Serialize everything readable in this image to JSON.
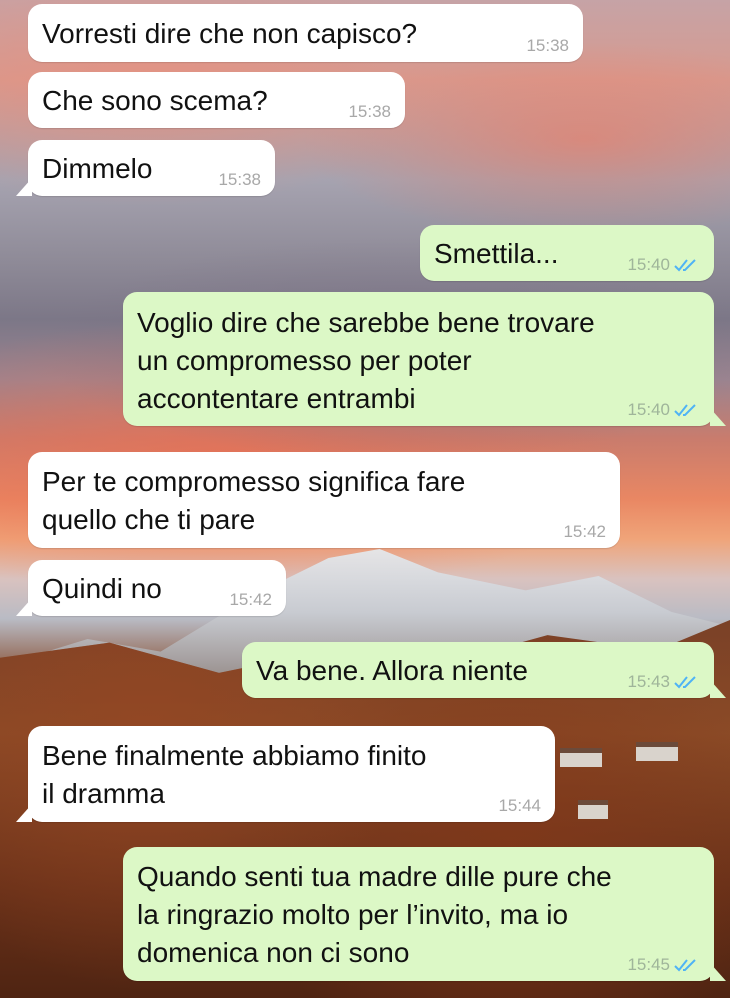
{
  "theme": {
    "incoming_bg": "#ffffff",
    "outgoing_bg": "#dcf8c6",
    "read_tick_color": "#4fb3f5"
  },
  "messages": [
    {
      "direction": "incoming",
      "text": "Vorresti dire che non capisco?",
      "time": "15:38"
    },
    {
      "direction": "incoming",
      "text": "Che sono scema?",
      "time": "15:38"
    },
    {
      "direction": "incoming",
      "text": "Dimmelo",
      "time": "15:38"
    },
    {
      "direction": "outgoing",
      "text": "Smettila...",
      "time": "15:40",
      "status": "read-double-check-icon"
    },
    {
      "direction": "outgoing",
      "text": "Voglio dire che sarebbe bene trovare\nun compromesso per poter\naccontentare entrambi",
      "time": "15:40",
      "status": "read-double-check-icon"
    },
    {
      "direction": "incoming",
      "text": "Per te compromesso significa fare\nquello che ti pare",
      "time": "15:42"
    },
    {
      "direction": "incoming",
      "text": "Quindi no",
      "time": "15:42"
    },
    {
      "direction": "outgoing",
      "text": "Va bene. Allora niente",
      "time": "15:43",
      "status": "read-double-check-icon"
    },
    {
      "direction": "incoming",
      "text": "Bene finalmente abbiamo finito\nil dramma",
      "time": "15:44"
    },
    {
      "direction": "outgoing",
      "text": "Quando senti tua madre dille pure che\nla ringrazio molto per l’invito, ma io\ndomenica non ci sono",
      "time": "15:45",
      "status": "read-double-check-icon"
    }
  ]
}
